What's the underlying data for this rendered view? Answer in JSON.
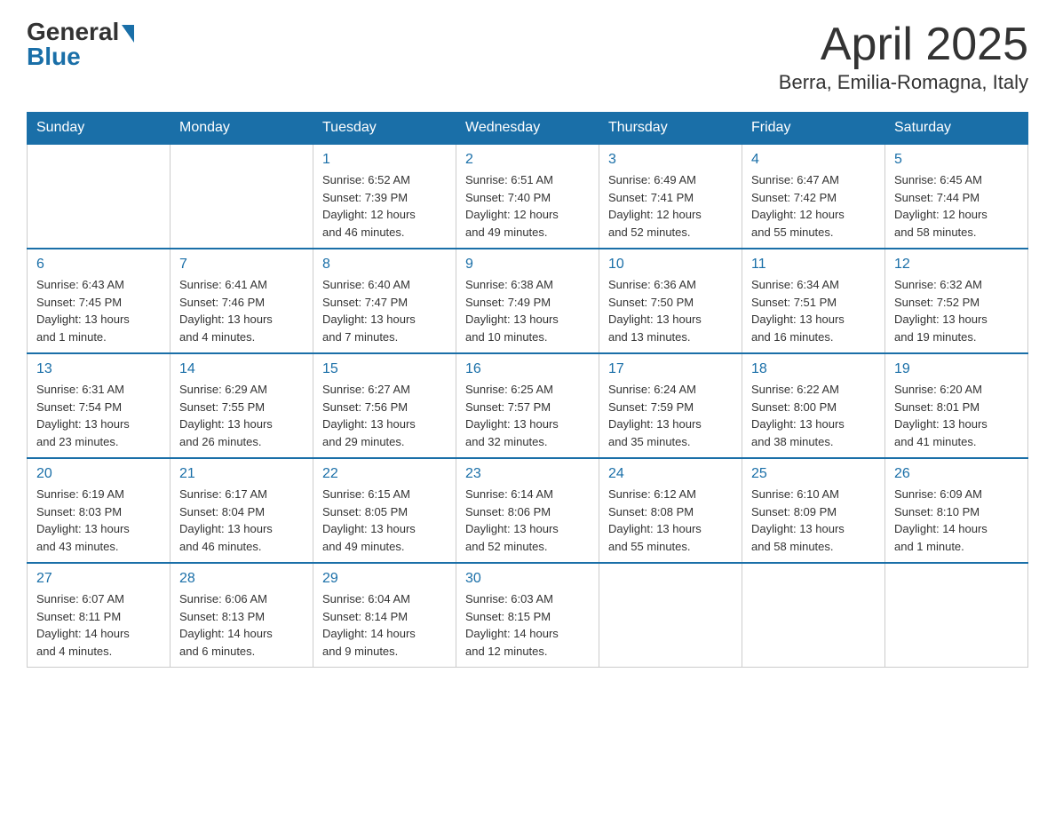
{
  "header": {
    "logo_general": "General",
    "logo_blue": "Blue",
    "month_title": "April 2025",
    "location": "Berra, Emilia-Romagna, Italy"
  },
  "days_of_week": [
    "Sunday",
    "Monday",
    "Tuesday",
    "Wednesday",
    "Thursday",
    "Friday",
    "Saturday"
  ],
  "weeks": [
    [
      {
        "day": "",
        "info": ""
      },
      {
        "day": "",
        "info": ""
      },
      {
        "day": "1",
        "info": "Sunrise: 6:52 AM\nSunset: 7:39 PM\nDaylight: 12 hours\nand 46 minutes."
      },
      {
        "day": "2",
        "info": "Sunrise: 6:51 AM\nSunset: 7:40 PM\nDaylight: 12 hours\nand 49 minutes."
      },
      {
        "day": "3",
        "info": "Sunrise: 6:49 AM\nSunset: 7:41 PM\nDaylight: 12 hours\nand 52 minutes."
      },
      {
        "day": "4",
        "info": "Sunrise: 6:47 AM\nSunset: 7:42 PM\nDaylight: 12 hours\nand 55 minutes."
      },
      {
        "day": "5",
        "info": "Sunrise: 6:45 AM\nSunset: 7:44 PM\nDaylight: 12 hours\nand 58 minutes."
      }
    ],
    [
      {
        "day": "6",
        "info": "Sunrise: 6:43 AM\nSunset: 7:45 PM\nDaylight: 13 hours\nand 1 minute."
      },
      {
        "day": "7",
        "info": "Sunrise: 6:41 AM\nSunset: 7:46 PM\nDaylight: 13 hours\nand 4 minutes."
      },
      {
        "day": "8",
        "info": "Sunrise: 6:40 AM\nSunset: 7:47 PM\nDaylight: 13 hours\nand 7 minutes."
      },
      {
        "day": "9",
        "info": "Sunrise: 6:38 AM\nSunset: 7:49 PM\nDaylight: 13 hours\nand 10 minutes."
      },
      {
        "day": "10",
        "info": "Sunrise: 6:36 AM\nSunset: 7:50 PM\nDaylight: 13 hours\nand 13 minutes."
      },
      {
        "day": "11",
        "info": "Sunrise: 6:34 AM\nSunset: 7:51 PM\nDaylight: 13 hours\nand 16 minutes."
      },
      {
        "day": "12",
        "info": "Sunrise: 6:32 AM\nSunset: 7:52 PM\nDaylight: 13 hours\nand 19 minutes."
      }
    ],
    [
      {
        "day": "13",
        "info": "Sunrise: 6:31 AM\nSunset: 7:54 PM\nDaylight: 13 hours\nand 23 minutes."
      },
      {
        "day": "14",
        "info": "Sunrise: 6:29 AM\nSunset: 7:55 PM\nDaylight: 13 hours\nand 26 minutes."
      },
      {
        "day": "15",
        "info": "Sunrise: 6:27 AM\nSunset: 7:56 PM\nDaylight: 13 hours\nand 29 minutes."
      },
      {
        "day": "16",
        "info": "Sunrise: 6:25 AM\nSunset: 7:57 PM\nDaylight: 13 hours\nand 32 minutes."
      },
      {
        "day": "17",
        "info": "Sunrise: 6:24 AM\nSunset: 7:59 PM\nDaylight: 13 hours\nand 35 minutes."
      },
      {
        "day": "18",
        "info": "Sunrise: 6:22 AM\nSunset: 8:00 PM\nDaylight: 13 hours\nand 38 minutes."
      },
      {
        "day": "19",
        "info": "Sunrise: 6:20 AM\nSunset: 8:01 PM\nDaylight: 13 hours\nand 41 minutes."
      }
    ],
    [
      {
        "day": "20",
        "info": "Sunrise: 6:19 AM\nSunset: 8:03 PM\nDaylight: 13 hours\nand 43 minutes."
      },
      {
        "day": "21",
        "info": "Sunrise: 6:17 AM\nSunset: 8:04 PM\nDaylight: 13 hours\nand 46 minutes."
      },
      {
        "day": "22",
        "info": "Sunrise: 6:15 AM\nSunset: 8:05 PM\nDaylight: 13 hours\nand 49 minutes."
      },
      {
        "day": "23",
        "info": "Sunrise: 6:14 AM\nSunset: 8:06 PM\nDaylight: 13 hours\nand 52 minutes."
      },
      {
        "day": "24",
        "info": "Sunrise: 6:12 AM\nSunset: 8:08 PM\nDaylight: 13 hours\nand 55 minutes."
      },
      {
        "day": "25",
        "info": "Sunrise: 6:10 AM\nSunset: 8:09 PM\nDaylight: 13 hours\nand 58 minutes."
      },
      {
        "day": "26",
        "info": "Sunrise: 6:09 AM\nSunset: 8:10 PM\nDaylight: 14 hours\nand 1 minute."
      }
    ],
    [
      {
        "day": "27",
        "info": "Sunrise: 6:07 AM\nSunset: 8:11 PM\nDaylight: 14 hours\nand 4 minutes."
      },
      {
        "day": "28",
        "info": "Sunrise: 6:06 AM\nSunset: 8:13 PM\nDaylight: 14 hours\nand 6 minutes."
      },
      {
        "day": "29",
        "info": "Sunrise: 6:04 AM\nSunset: 8:14 PM\nDaylight: 14 hours\nand 9 minutes."
      },
      {
        "day": "30",
        "info": "Sunrise: 6:03 AM\nSunset: 8:15 PM\nDaylight: 14 hours\nand 12 minutes."
      },
      {
        "day": "",
        "info": ""
      },
      {
        "day": "",
        "info": ""
      },
      {
        "day": "",
        "info": ""
      }
    ]
  ]
}
